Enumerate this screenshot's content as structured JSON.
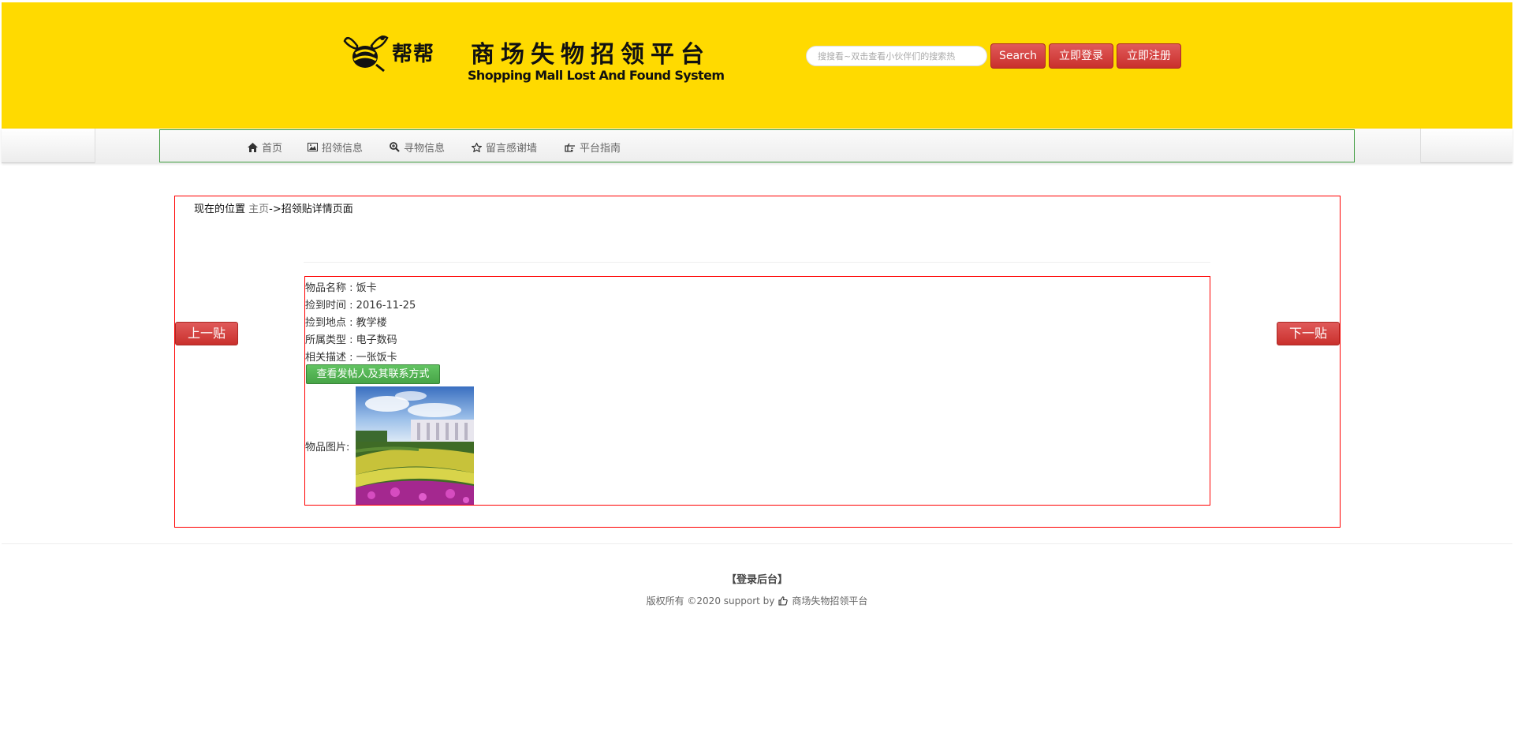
{
  "header": {
    "logo_text": "帮帮",
    "title": "商场失物招领平台",
    "subtitle": "Shopping Mall Lost And Found System",
    "search_placeholder": "搜搜看~双击查看小伙伴们的搜索热",
    "search_label": "Search",
    "login_label": "立即登录",
    "register_label": "立即注册"
  },
  "nav": {
    "items": [
      {
        "label": "首页",
        "icon": "home-icon"
      },
      {
        "label": "招领信息",
        "icon": "picture-icon"
      },
      {
        "label": "寻物信息",
        "icon": "zoom-in-icon"
      },
      {
        "label": "留言感谢墙",
        "icon": "star-icon"
      },
      {
        "label": "平台指南",
        "icon": "hand-right-icon"
      }
    ]
  },
  "breadcrumb": {
    "prefix": "现在的位置",
    "home": "主页",
    "current": "->招领贴详情页面"
  },
  "pager": {
    "prev_label": "上一贴",
    "next_label": "下一贴"
  },
  "detail": {
    "name_label": "物品名称",
    "name_value": "饭卡",
    "time_label": "捡到时间",
    "time_value": "2016-11-25",
    "place_label": "捡到地点",
    "place_value": "教学楼",
    "type_label": "所属类型",
    "type_value": "电子数码",
    "desc_label": "相关描述",
    "desc_value": "一张饭卡",
    "contact_button": "查看发帖人及其联系方式",
    "image_label": "物品图片:"
  },
  "footer": {
    "admin_link": "【登录后台】",
    "copyright": "版权所有 ©2020 support by",
    "platform": "商场失物招领平台",
    "icon": "thumbs-up-icon"
  },
  "colors": {
    "header_bg": "#ffda00",
    "button_red": "#c9302c",
    "button_green": "#47a447",
    "box_border": "#ff0000",
    "nav_border": "#3c9a3c"
  }
}
